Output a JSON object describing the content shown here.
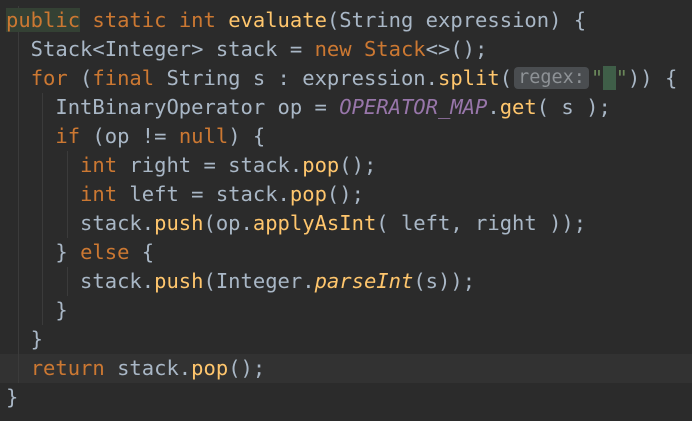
{
  "editor": {
    "lines": [
      {
        "tokens": [
          {
            "text": "public",
            "kind": "kw-hl"
          },
          {
            "text": " ",
            "kind": "plain"
          },
          {
            "text": "static",
            "kind": "kw"
          },
          {
            "text": " ",
            "kind": "plain"
          },
          {
            "text": "int",
            "kind": "kw"
          },
          {
            "text": " ",
            "kind": "plain"
          },
          {
            "text": "evaluate",
            "kind": "fn"
          },
          {
            "text": "(String expression) {",
            "kind": "plain"
          }
        ]
      },
      {
        "tokens": [
          {
            "text": "  Stack<Integer> stack = ",
            "kind": "plain"
          },
          {
            "text": "new",
            "kind": "kw"
          },
          {
            "text": " ",
            "kind": "plain"
          },
          {
            "text": "Stack",
            "kind": "kw"
          },
          {
            "text": "<>();",
            "kind": "plain"
          }
        ]
      },
      {
        "tokens": [
          {
            "text": "  ",
            "kind": "plain"
          },
          {
            "text": "for",
            "kind": "kw"
          },
          {
            "text": " (",
            "kind": "plain"
          },
          {
            "text": "final",
            "kind": "kw"
          },
          {
            "text": " String s : expression.",
            "kind": "plain"
          },
          {
            "text": "split",
            "kind": "fn"
          },
          {
            "text": "(",
            "kind": "plain"
          },
          {
            "text": "regex:",
            "kind": "hint"
          },
          {
            "text": "\"",
            "kind": "str"
          },
          {
            "text": " ",
            "kind": "caret-hl"
          },
          {
            "text": "\"",
            "kind": "str"
          },
          {
            "text": ")) {",
            "kind": "plain"
          }
        ]
      },
      {
        "tokens": [
          {
            "text": "    IntBinaryOperator op = ",
            "kind": "plain"
          },
          {
            "text": "OPERATOR_MAP",
            "kind": "const"
          },
          {
            "text": ".",
            "kind": "plain"
          },
          {
            "text": "get",
            "kind": "fn"
          },
          {
            "text": "( s );",
            "kind": "plain"
          }
        ]
      },
      {
        "tokens": [
          {
            "text": "    ",
            "kind": "plain"
          },
          {
            "text": "if",
            "kind": "kw"
          },
          {
            "text": " (op != ",
            "kind": "plain"
          },
          {
            "text": "null",
            "kind": "kw"
          },
          {
            "text": ") {",
            "kind": "plain"
          }
        ]
      },
      {
        "tokens": [
          {
            "text": "      ",
            "kind": "plain"
          },
          {
            "text": "int",
            "kind": "kw"
          },
          {
            "text": " right = stack.",
            "kind": "plain"
          },
          {
            "text": "pop",
            "kind": "fn"
          },
          {
            "text": "();",
            "kind": "plain"
          }
        ]
      },
      {
        "tokens": [
          {
            "text": "      ",
            "kind": "plain"
          },
          {
            "text": "int",
            "kind": "kw"
          },
          {
            "text": " left = stack.",
            "kind": "plain"
          },
          {
            "text": "pop",
            "kind": "fn"
          },
          {
            "text": "();",
            "kind": "plain"
          }
        ]
      },
      {
        "tokens": [
          {
            "text": "      stack.",
            "kind": "plain"
          },
          {
            "text": "push",
            "kind": "fn"
          },
          {
            "text": "(op.",
            "kind": "plain"
          },
          {
            "text": "applyAsInt",
            "kind": "fn"
          },
          {
            "text": "( left, right ));",
            "kind": "plain"
          }
        ]
      },
      {
        "tokens": [
          {
            "text": "    } ",
            "kind": "plain"
          },
          {
            "text": "else",
            "kind": "kw"
          },
          {
            "text": " {",
            "kind": "plain"
          }
        ]
      },
      {
        "tokens": [
          {
            "text": "      stack.",
            "kind": "plain"
          },
          {
            "text": "push",
            "kind": "fn"
          },
          {
            "text": "(Integer.",
            "kind": "plain"
          },
          {
            "text": "parseInt",
            "kind": "static-call"
          },
          {
            "text": "(s));",
            "kind": "plain"
          }
        ]
      },
      {
        "tokens": [
          {
            "text": "    }",
            "kind": "plain"
          }
        ]
      },
      {
        "tokens": [
          {
            "text": "  }",
            "kind": "plain"
          }
        ]
      },
      {
        "current": true,
        "tokens": [
          {
            "text": "  ",
            "kind": "plain"
          },
          {
            "text": "return",
            "kind": "kw"
          },
          {
            "text": " stack.",
            "kind": "plain"
          },
          {
            "text": "pop",
            "kind": "fn"
          },
          {
            "text": "();",
            "kind": "plain"
          }
        ]
      },
      {
        "tokens": [
          {
            "text": "}",
            "kind": "plain"
          }
        ]
      }
    ]
  }
}
